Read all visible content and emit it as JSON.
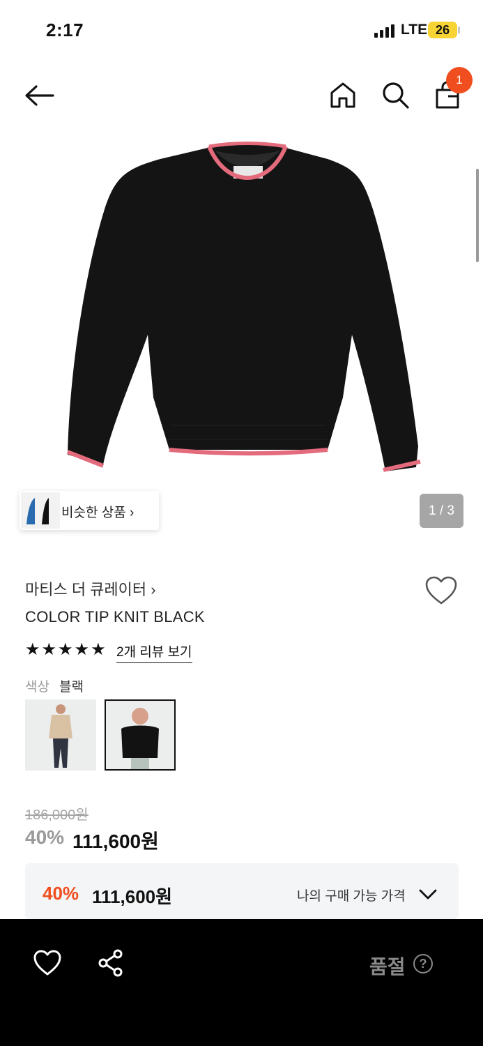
{
  "status_bar": {
    "time": "2:17",
    "network": "LTE",
    "battery": "26"
  },
  "nav": {
    "cart_count": "1",
    "icons": [
      "back-arrow-icon",
      "home-icon",
      "search-icon",
      "shopping-bag-icon"
    ]
  },
  "gallery": {
    "similar_label": "비슷한 상품",
    "page_indicator": "1 / 3"
  },
  "product": {
    "brand": "마티스 더 큐레이터",
    "name": "COLOR TIP KNIT BLACK",
    "rating_stars": 5,
    "review_link": "2개 리뷰 보기",
    "color_label": "색상",
    "color_value": "블랙",
    "swatches": [
      "beige-knit",
      "black-knit"
    ],
    "selected_swatch": 1,
    "original_price": "186,000원",
    "discount_percent": "40%",
    "sale_price": "111,600원"
  },
  "my_price": {
    "discount_percent": "40%",
    "price": "111,600원",
    "label": "나의 구매 가능 가격"
  },
  "bottom_bar": {
    "soldout_label": "품절",
    "help_icon_text": "?"
  },
  "colors": {
    "accent": "#f04e1e",
    "bottom_bar": "#000000",
    "battery": "#f7d334"
  }
}
